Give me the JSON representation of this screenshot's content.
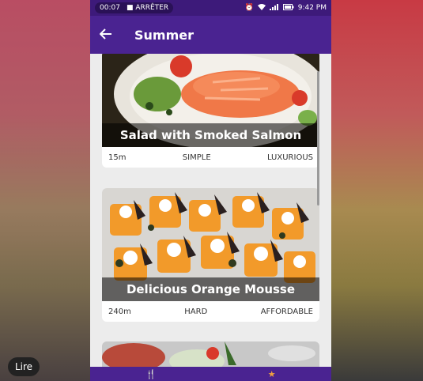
{
  "status_bar": {
    "time_left": "00:07",
    "stop_label": "ARRÊTER",
    "time_right": "9:42 PM"
  },
  "app_bar": {
    "title": "Summer"
  },
  "meals": [
    {
      "title": "Salad with Smoked Salmon",
      "duration": "15m",
      "complexity": "SIMPLE",
      "affordability": "LUXURIOUS"
    },
    {
      "title": "Delicious Orange Mousse",
      "duration": "240m",
      "complexity": "HARD",
      "affordability": "AFFORDABLE"
    }
  ],
  "overlay": {
    "read_button": "Lire"
  },
  "colors": {
    "primary": "#4a2391",
    "status": "#3d1a7a",
    "accent": "#f0a040"
  }
}
